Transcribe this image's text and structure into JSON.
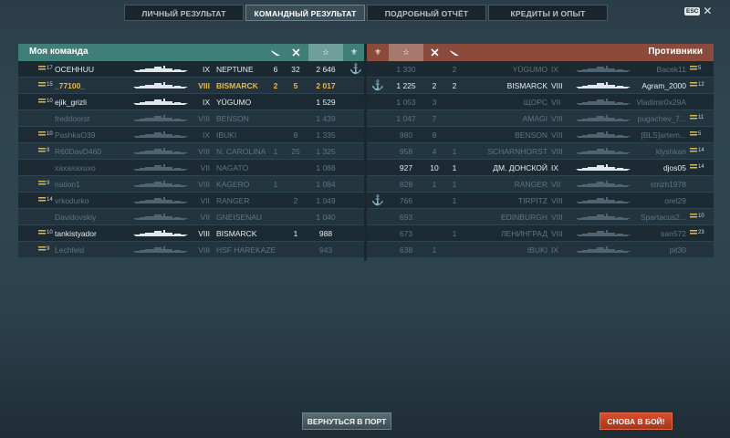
{
  "tabs": [
    "ЛИЧНЫЙ РЕЗУЛЬТАТ",
    "КОМАНДНЫЙ РЕЗУЛЬТАТ",
    "ПОДРОБНЫЙ ОТЧЁТ",
    "КРЕДИТЫ И ОПЫТ"
  ],
  "active_tab": 1,
  "esc_label": "ESC",
  "my_team_title": "Моя команда",
  "enemy_team_title": "Противники",
  "header_icons": [
    "plane-kills-icon",
    "ship-kills-icon",
    "star-xp-icon",
    "laurel-icon"
  ],
  "my_team": [
    {
      "rank": "17",
      "player": "OCEHHUU",
      "tier": "IX",
      "ship": "NEPTUNE",
      "planes": "6",
      "kills": "32",
      "xp": "2 646",
      "anchor": true,
      "alive": true,
      "hl": false
    },
    {
      "rank": "15",
      "player": "_77100_",
      "tier": "VIII",
      "ship": "BISMARCK",
      "planes": "2",
      "kills": "5",
      "xp": "2 017",
      "anchor": false,
      "alive": true,
      "hl": true
    },
    {
      "rank": "10",
      "player": "ejik_grizli",
      "tier": "IX",
      "ship": "YŪGUMO",
      "planes": "",
      "kills": "",
      "xp": "1 529",
      "anchor": false,
      "alive": true,
      "hl": false
    },
    {
      "rank": "",
      "player": "freddoorst",
      "tier": "VIII",
      "ship": "BENSON",
      "planes": "",
      "kills": "",
      "xp": "1 439",
      "anchor": false,
      "alive": false,
      "hl": false
    },
    {
      "rank": "10",
      "player": "PashkaO39",
      "tier": "IX",
      "ship": "IBUKI",
      "planes": "",
      "kills": "8",
      "xp": "1 335",
      "anchor": false,
      "alive": false,
      "hl": false
    },
    {
      "rank": "9",
      "player": "R60DavD460",
      "tier": "VIII",
      "ship": "N. CAROLINA",
      "planes": "1",
      "kills": "25",
      "xp": "1 325",
      "anchor": false,
      "alive": false,
      "hl": false
    },
    {
      "rank": "",
      "player": "xaxaxaxuxo",
      "tier": "VII",
      "ship": "NAGATO",
      "planes": "",
      "kills": "",
      "xp": "1 088",
      "anchor": false,
      "alive": false,
      "hl": false
    },
    {
      "rank": "9",
      "player": "nation1",
      "tier": "VIII",
      "ship": "KAGERO",
      "planes": "1",
      "kills": "",
      "xp": "1 084",
      "anchor": false,
      "alive": false,
      "hl": false
    },
    {
      "rank": "14",
      "player": "vrkodurko",
      "tier": "VII",
      "ship": "RANGER",
      "planes": "",
      "kills": "2",
      "xp": "1 049",
      "anchor": false,
      "alive": false,
      "hl": false
    },
    {
      "rank": "",
      "player": "Davidovskiy",
      "tier": "VII",
      "ship": "GNEISENAU",
      "planes": "",
      "kills": "",
      "xp": "1 040",
      "anchor": false,
      "alive": false,
      "hl": false
    },
    {
      "rank": "10",
      "player": "tankistyador",
      "tier": "VIII",
      "ship": "BISMARCK",
      "planes": "",
      "kills": "1",
      "xp": "988",
      "anchor": false,
      "alive": true,
      "hl": false
    },
    {
      "rank": "9",
      "player": "Lechfeld",
      "tier": "VIII",
      "ship": "HSF HAREKAZE",
      "planes": "",
      "kills": "",
      "xp": "943",
      "anchor": false,
      "alive": false,
      "hl": false
    }
  ],
  "enemy_team": [
    {
      "anchor": false,
      "xp": "1 330",
      "kills": "",
      "planes": "2",
      "ship": "YŪGUMO",
      "tier": "IX",
      "player": "Bacek11",
      "rank": "5",
      "alive": false
    },
    {
      "anchor": true,
      "xp": "1 225",
      "kills": "2",
      "planes": "2",
      "ship": "BISMARCK",
      "tier": "VIII",
      "player": "Agram_2000",
      "rank": "12",
      "alive": true
    },
    {
      "anchor": false,
      "xp": "1 053",
      "kills": "3",
      "planes": "",
      "ship": "ЩОРС",
      "tier": "VII",
      "player": "Vladimir0x29A",
      "rank": "",
      "alive": false
    },
    {
      "anchor": false,
      "xp": "1 047",
      "kills": "7",
      "planes": "",
      "ship": "AMAGI",
      "tier": "VIII",
      "player": "pugachev_7...",
      "rank": "11",
      "alive": false
    },
    {
      "anchor": false,
      "xp": "980",
      "kills": "8",
      "planes": "",
      "ship": "BENSON",
      "tier": "VIII",
      "player": "[BLS]artem...",
      "rank": "5",
      "alive": false
    },
    {
      "anchor": false,
      "xp": "958",
      "kills": "4",
      "planes": "1",
      "ship": "SCHARNHORST",
      "tier": "VIII",
      "player": "klyshkan",
      "rank": "14",
      "alive": false
    },
    {
      "anchor": false,
      "xp": "927",
      "kills": "10",
      "planes": "1",
      "ship": "ДМ. ДОНСКОЙ",
      "tier": "IX",
      "player": "djos05",
      "rank": "14",
      "alive": true
    },
    {
      "anchor": false,
      "xp": "828",
      "kills": "1",
      "planes": "1",
      "ship": "RANGER",
      "tier": "VII",
      "player": "strizh1978",
      "rank": "",
      "alive": false
    },
    {
      "anchor": true,
      "xp": "766",
      "kills": "",
      "planes": "1",
      "ship": "TIRPITZ",
      "tier": "VIII",
      "player": "orel29",
      "rank": "",
      "alive": false
    },
    {
      "anchor": false,
      "xp": "693",
      "kills": "",
      "planes": "",
      "ship": "EDINBURGH",
      "tier": "VIII",
      "player": "Spartacus2...",
      "rank": "10",
      "alive": false
    },
    {
      "anchor": false,
      "xp": "673",
      "kills": "",
      "planes": "1",
      "ship": "ЛЕНИНГРАД",
      "tier": "VIII",
      "player": "san572",
      "rank": "23",
      "alive": false
    },
    {
      "anchor": false,
      "xp": "638",
      "kills": "1",
      "planes": "",
      "ship": "IBUKI",
      "tier": "IX",
      "player": "pit30",
      "rank": "",
      "alive": false
    }
  ],
  "buttons": {
    "return_port": "ВЕРНУТЬСЯ В ПОРТ",
    "battle_again": "СНОВА В БОЙ!"
  },
  "colors": {
    "my_team": "#3f7f78",
    "enemy_team": "#8a4b3d",
    "highlight": "#e6b84a",
    "battle_btn": "#c8452a"
  }
}
